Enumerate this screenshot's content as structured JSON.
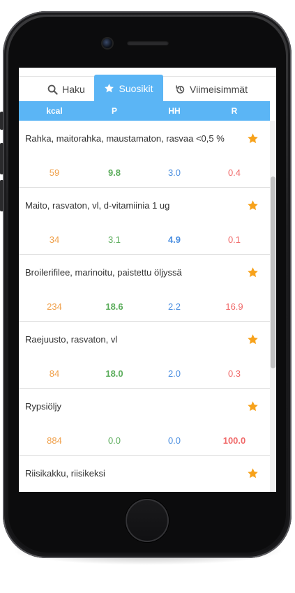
{
  "tabs": [
    {
      "label": "Haku",
      "icon": "search-icon"
    },
    {
      "label": "Suosikit",
      "icon": "star-icon",
      "active": true
    },
    {
      "label": "Viimeisimmät",
      "icon": "history-icon"
    }
  ],
  "columns": [
    "kcal",
    "P",
    "HH",
    "R"
  ],
  "colors": {
    "accent": "#5bb5f5",
    "kcal": "#f0a04a",
    "protein": "#5cad5c",
    "carbs": "#4a8ee0",
    "fat": "#f06a6a",
    "star": "#f7a21b"
  },
  "foods": [
    {
      "name": "Rahka, maitorahka, maustamaton, rasvaa <0,5 %",
      "kcal": "59",
      "p": "9.8",
      "hh": "3.0",
      "r": "0.4",
      "highlight": "p"
    },
    {
      "name": "Maito, rasvaton, vl, d-vitamiinia 1 ug",
      "kcal": "34",
      "p": "3.1",
      "hh": "4.9",
      "r": "0.1",
      "highlight": "hh"
    },
    {
      "name": "Broilerifilee, marinoitu, paistettu öljyssä",
      "kcal": "234",
      "p": "18.6",
      "hh": "2.2",
      "r": "16.9",
      "highlight": "p"
    },
    {
      "name": "Raejuusto, rasvaton, vl",
      "kcal": "84",
      "p": "18.0",
      "hh": "2.0",
      "r": "0.3",
      "highlight": "p"
    },
    {
      "name": "Rypsiöljy",
      "kcal": "884",
      "p": "0.0",
      "hh": "0.0",
      "r": "100.0",
      "highlight": "r"
    },
    {
      "name": "Riisikakku, riisikeksi",
      "kcal": "",
      "p": "",
      "hh": "",
      "r": "",
      "highlight": ""
    }
  ]
}
